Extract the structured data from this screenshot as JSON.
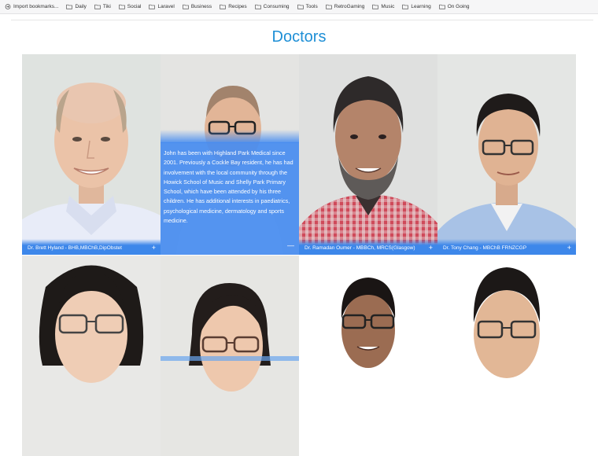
{
  "bookmarks": [
    {
      "label": "Import bookmarks...",
      "icon": "import-icon"
    },
    {
      "label": "Daily",
      "icon": "folder-icon"
    },
    {
      "label": "Tiki",
      "icon": "folder-icon"
    },
    {
      "label": "Social",
      "icon": "folder-icon"
    },
    {
      "label": "Laravel",
      "icon": "folder-icon"
    },
    {
      "label": "Business",
      "icon": "folder-icon"
    },
    {
      "label": "Recipes",
      "icon": "folder-icon"
    },
    {
      "label": "Consuming",
      "icon": "folder-icon"
    },
    {
      "label": "Tools",
      "icon": "folder-icon"
    },
    {
      "label": "RetroGaming",
      "icon": "folder-icon"
    },
    {
      "label": "Music",
      "icon": "folder-icon"
    },
    {
      "label": "Learning",
      "icon": "folder-icon"
    },
    {
      "label": "On Going",
      "icon": "folder-icon"
    }
  ],
  "page": {
    "title": "Doctors"
  },
  "colors": {
    "accent": "#1e8fd6",
    "caption_bg": "#3d87ea"
  },
  "doctors": [
    {
      "name": "Dr. Brett Hyland - BHB,MBChB,DipObstet",
      "toggle": "+"
    },
    {
      "name": "",
      "toggle": "—",
      "bio": "John has been with Highland Park Medical since 2001. Previously a Cockle Bay resident, he has had involvement with the local community through the Howick School of Music and Shelly Park Primary School, which have been attended by his three children. He has additional interests in paediatrics, psychological medicine, dermatology and sports medicine."
    },
    {
      "name": "Dr. Ramadan Oumer - MBBCh, MRCS(Glasgow)",
      "toggle": "+"
    },
    {
      "name": "Dr. Tony Chang - MBChB FRNZCGP",
      "toggle": "+"
    },
    {
      "name": "",
      "toggle": ""
    },
    {
      "name": "",
      "toggle": ""
    },
    {
      "name": "",
      "toggle": ""
    },
    {
      "name": "",
      "toggle": ""
    }
  ]
}
